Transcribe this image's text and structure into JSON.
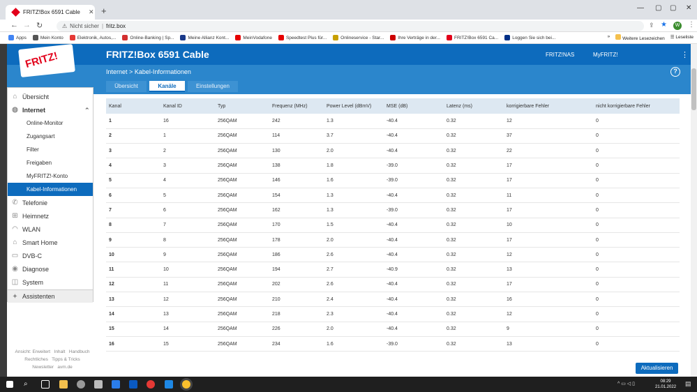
{
  "browser": {
    "tab_title": "FRITZ!Box 6591 Cable",
    "new_tab": "+",
    "security": "Nicht sicher",
    "url": "fritz.box",
    "bookmarks": [
      "Apps",
      "Mein Konto",
      "Elektronik, Autos,...",
      "Online-Banking | Sp...",
      "Meine Allianz Kont...",
      "MeinVodafone",
      "Speedtest Plus für...",
      "Onlineservice - Star...",
      "Ihre Verträge in der...",
      "FRITZ!Box 6591 Ca...",
      "Loggen Sie sich bei..."
    ],
    "bookmarks_more": "»",
    "other_bookmarks": "Weitere Lesezeichen",
    "reading_list": "Leseliste",
    "profile_initial": "W"
  },
  "header": {
    "logo": "FRITZ!",
    "product": "FRITZ!Box 6591 Cable",
    "link_nas": "FRITZ!NAS",
    "link_myfritz": "MyFRITZ!"
  },
  "breadcrumb": {
    "parent": "Internet",
    "sep": ">",
    "current": "Kabel-Informationen"
  },
  "help": "?",
  "subtabs": [
    "Übersicht",
    "Kanäle",
    "Einstellungen"
  ],
  "sidebar": {
    "items": [
      {
        "label": "Übersicht",
        "icon": "home-icon",
        "glyph": "⌂"
      },
      {
        "label": "Internet",
        "icon": "globe-icon",
        "glyph": "◍"
      },
      {
        "label": "Online-Monitor"
      },
      {
        "label": "Zugangsart"
      },
      {
        "label": "Filter"
      },
      {
        "label": "Freigaben"
      },
      {
        "label": "MyFRITZ!-Konto"
      },
      {
        "label": "Kabel-Informationen"
      },
      {
        "label": "Telefonie",
        "icon": "phone-icon",
        "glyph": "✆"
      },
      {
        "label": "Heimnetz",
        "icon": "network-icon",
        "glyph": "⊞"
      },
      {
        "label": "WLAN",
        "icon": "wifi-icon",
        "glyph": "◠"
      },
      {
        "label": "Smart Home",
        "icon": "smarthome-icon",
        "glyph": "⌂"
      },
      {
        "label": "DVB-C",
        "icon": "tv-icon",
        "glyph": "▭"
      },
      {
        "label": "Diagnose",
        "icon": "diagnose-icon",
        "glyph": "◉"
      },
      {
        "label": "System",
        "icon": "system-icon",
        "glyph": "◫"
      },
      {
        "label": "Assistenten",
        "icon": "wizard-icon",
        "glyph": "✦"
      }
    ]
  },
  "footer": {
    "view": "Ansicht: Erweitert",
    "content": "Inhalt",
    "manual": "Handbuch",
    "legal": "Rechtliches",
    "tips": "Tipps & Tricks",
    "newsletter": "Newsletter",
    "site": "avm.de"
  },
  "table": {
    "headers": [
      "Kanal",
      "Kanal ID",
      "Typ",
      "Frequenz (MHz)",
      "Power Level (dBmV)",
      "MSE (dB)",
      "Latenz (ms)",
      "korrigierbare Fehler",
      "nicht korrigierbare Fehler"
    ],
    "rows": [
      [
        "1",
        "16",
        "256QAM",
        "242",
        "1.3",
        "-40.4",
        "0.32",
        "12",
        "0"
      ],
      [
        "2",
        "1",
        "256QAM",
        "114",
        "3.7",
        "-40.4",
        "0.32",
        "37",
        "0"
      ],
      [
        "3",
        "2",
        "256QAM",
        "130",
        "2.0",
        "-40.4",
        "0.32",
        "22",
        "0"
      ],
      [
        "4",
        "3",
        "256QAM",
        "138",
        "1.8",
        "-39.0",
        "0.32",
        "17",
        "0"
      ],
      [
        "5",
        "4",
        "256QAM",
        "146",
        "1.6",
        "-39.0",
        "0.32",
        "17",
        "0"
      ],
      [
        "6",
        "5",
        "256QAM",
        "154",
        "1.3",
        "-40.4",
        "0.32",
        "11",
        "0"
      ],
      [
        "7",
        "6",
        "256QAM",
        "162",
        "1.3",
        "-39.0",
        "0.32",
        "17",
        "0"
      ],
      [
        "8",
        "7",
        "256QAM",
        "170",
        "1.5",
        "-40.4",
        "0.32",
        "10",
        "0"
      ],
      [
        "9",
        "8",
        "256QAM",
        "178",
        "2.0",
        "-40.4",
        "0.32",
        "17",
        "0"
      ],
      [
        "10",
        "9",
        "256QAM",
        "186",
        "2.6",
        "-40.4",
        "0.32",
        "12",
        "0"
      ],
      [
        "11",
        "10",
        "256QAM",
        "194",
        "2.7",
        "-40.9",
        "0.32",
        "13",
        "0"
      ],
      [
        "12",
        "11",
        "256QAM",
        "202",
        "2.6",
        "-40.4",
        "0.32",
        "17",
        "0"
      ],
      [
        "13",
        "12",
        "256QAM",
        "210",
        "2.4",
        "-40.4",
        "0.32",
        "16",
        "0"
      ],
      [
        "14",
        "13",
        "256QAM",
        "218",
        "2.3",
        "-40.4",
        "0.32",
        "12",
        "0"
      ],
      [
        "15",
        "14",
        "256QAM",
        "226",
        "2.0",
        "-40.4",
        "0.32",
        "9",
        "0"
      ],
      [
        "16",
        "15",
        "256QAM",
        "234",
        "1.6",
        "-39.0",
        "0.32",
        "13",
        "0"
      ]
    ]
  },
  "update_button": "Aktualisieren",
  "clock": {
    "time": "08:29",
    "date": "21.01.2022"
  },
  "colors": {
    "brand_blue": "#0d6bbd",
    "subheader_blue": "#2b86cc",
    "fritz_red": "#e2001a"
  }
}
